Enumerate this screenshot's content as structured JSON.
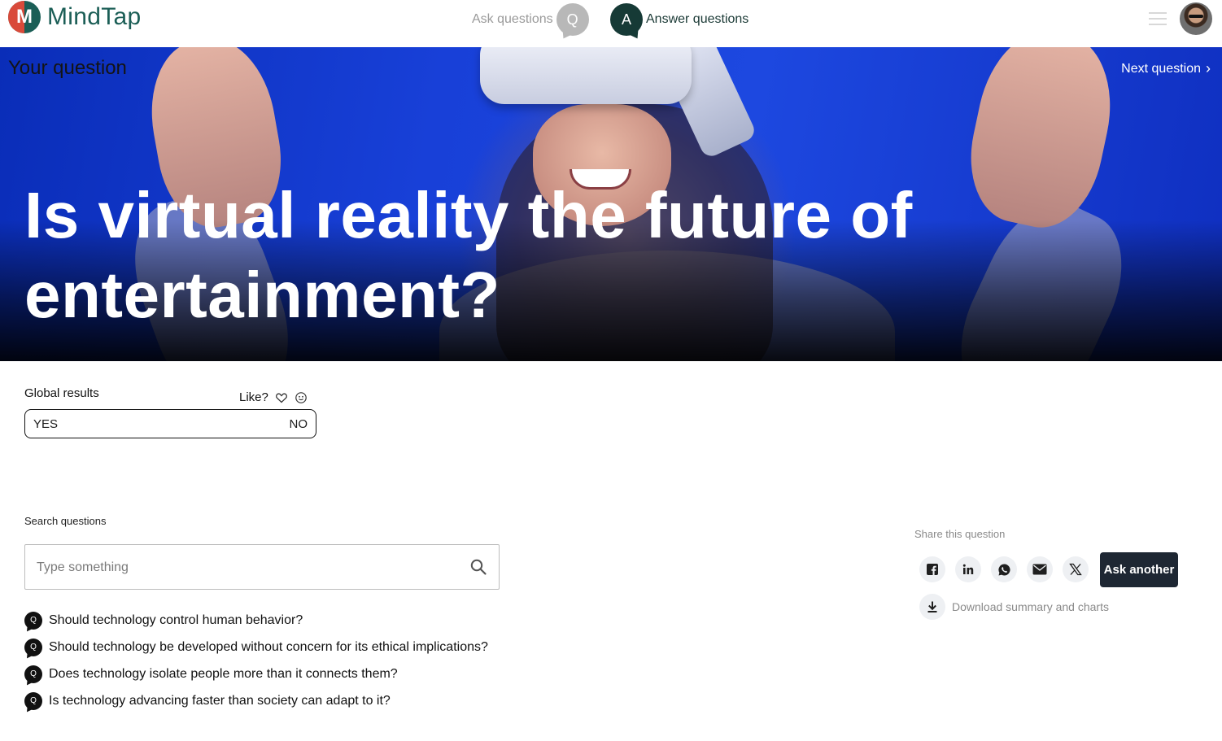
{
  "header": {
    "logo_letter": "M",
    "logo_text": "MindTap",
    "ask_label": "Ask questions",
    "ask_badge": "Q",
    "answer_badge": "A",
    "answer_label": "Answer questions"
  },
  "hero": {
    "your_question_label": "Your question",
    "next_question_label": "Next question",
    "title": "Is virtual reality the future of entertainment?"
  },
  "results": {
    "global_label": "Global results",
    "like_label": "Like?",
    "yes_label": "YES",
    "no_label": "NO"
  },
  "search": {
    "label": "Search questions",
    "placeholder": "Type something"
  },
  "questions": {
    "badge": "Q",
    "items": [
      "Should technology control human behavior?",
      "Should technology be developed without concern for its ethical implications?",
      "Does technology isolate people more than it connects them?",
      "Is technology advancing faster than society can adapt to it?"
    ]
  },
  "share": {
    "label": "Share this question",
    "icons": [
      "facebook-icon",
      "linkedin-icon",
      "whatsapp-icon",
      "email-icon",
      "x-icon"
    ],
    "ask_another_label": "Ask another",
    "download_label": "Download summary and charts"
  },
  "colors": {
    "brand_teal": "#1b5e56",
    "brand_red": "#d94a3a",
    "dark_button": "#1e2733",
    "hero_blue": "#1840d8"
  }
}
